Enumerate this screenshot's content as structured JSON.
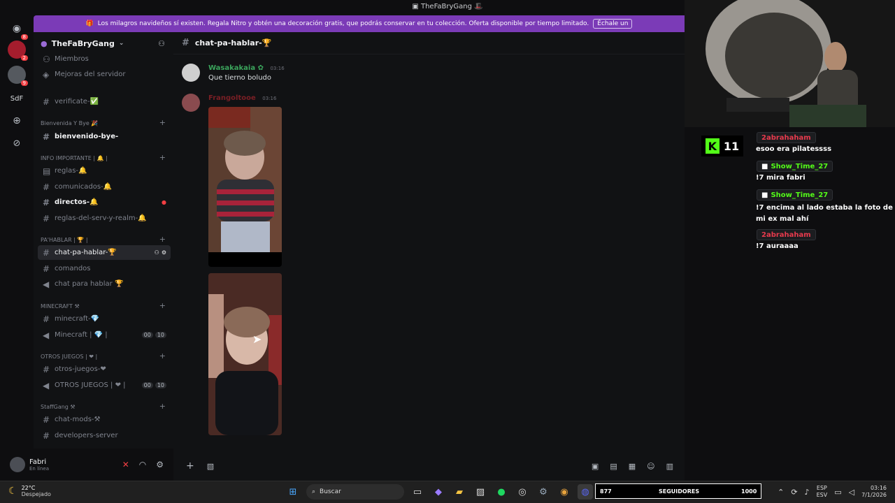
{
  "window": {
    "title": "TheFaBryGang"
  },
  "servers": [
    {
      "name": "discord-home",
      "badge": "8"
    },
    {
      "name": "server-red",
      "badge": "2"
    },
    {
      "name": "server-gray",
      "badge": "9"
    },
    {
      "name": "SdF",
      "badge": ""
    }
  ],
  "banner": {
    "text": "Los milagros navideños sí existen. Regala Nitro y obtén una decoración gratis, que podrás conservar en tu colección. Oferta disponible por tiempo limitado.",
    "cta": "Échale un"
  },
  "guild": {
    "name": "TheFaBryGang"
  },
  "sidebar": {
    "top_items": [
      "Miembros",
      "Mejoras del servidor"
    ],
    "channels": [
      {
        "label": "verificate-✅",
        "type": "text"
      },
      {
        "label": "Bienvenida Y Bye 🎉",
        "type": "category"
      },
      {
        "label": "bienvenido-bye-",
        "type": "text",
        "bold": true
      },
      {
        "label": "INFO IMPORTANTE | 🔔 |",
        "type": "category"
      },
      {
        "label": "reglas-🔔",
        "type": "rules"
      },
      {
        "label": "comunicados-🔔",
        "type": "text"
      },
      {
        "label": "directos-🔔",
        "type": "text",
        "bold": true
      },
      {
        "label": "reglas-del-serv-y-realm-🔔",
        "type": "text"
      },
      {
        "label": "PA'HABLAR | 🏆 |",
        "type": "category"
      },
      {
        "label": "chat-pa-hablar-🏆",
        "type": "text",
        "active": true
      },
      {
        "label": "comandos",
        "type": "text"
      },
      {
        "label": "chat para hablar 🏆",
        "type": "voice"
      },
      {
        "label": "MINECRAFT ⚒",
        "type": "category"
      },
      {
        "label": "minecraft-💎",
        "type": "text"
      },
      {
        "label": "Minecraft | 💎 |",
        "type": "voice",
        "pills": [
          "00",
          "10"
        ]
      },
      {
        "label": "OTROS JUEGOS | ❤ |",
        "type": "category"
      },
      {
        "label": "otros-juegos-❤",
        "type": "text"
      },
      {
        "label": "OTROS JUEGOS | ❤ |",
        "type": "voice",
        "pills": [
          "00",
          "10"
        ]
      },
      {
        "label": "StaffGang ⚒",
        "type": "category"
      },
      {
        "label": "chat-mods-⚒",
        "type": "text"
      },
      {
        "label": "developers-server",
        "type": "text"
      }
    ]
  },
  "user": {
    "name": "Fabri",
    "status": "En línea"
  },
  "channel_header": {
    "title": "chat-pa-hablar-🏆"
  },
  "messages": [
    {
      "author": "Wasakakaia",
      "time": "03:16",
      "text": "Que tierno boludo",
      "color": "#3ba55c"
    },
    {
      "author": "Frangoltooe",
      "time": "03:16",
      "text": "",
      "color": "#7a1f25"
    }
  ],
  "stream_chat": [
    {
      "user": "2abrahaham",
      "color": "#e83a4d",
      "text": "esoo era pilatessss"
    },
    {
      "user": "Show_Time_27",
      "color": "#53fc18",
      "text": "!7 mira fabri"
    },
    {
      "user": "Show_Time_27",
      "color": "#53fc18",
      "text": "!7 encima al lado estaba la foto de mi ex mal ahí"
    },
    {
      "user": "2abrahaham",
      "color": "#e83a4d",
      "text": "!7 auraaaa"
    }
  ],
  "kick": {
    "viewers": "11"
  },
  "taskbar": {
    "weather_temp": "22°C",
    "weather_desc": "Despejado",
    "search_placeholder": "Buscar",
    "followers_current": "877",
    "followers_label": "SEGUIDORES",
    "followers_goal": "1000",
    "lang_top": "ESP",
    "lang_bottom": "ESV",
    "time": "03:16",
    "date": "7/1/2026"
  },
  "colors": {
    "accent": "#7b3bb7",
    "kick_green": "#53fc18"
  }
}
